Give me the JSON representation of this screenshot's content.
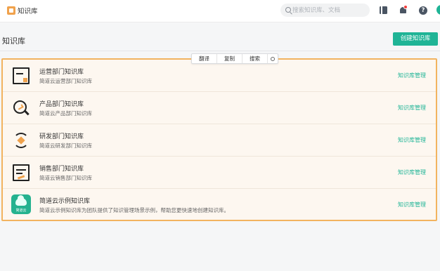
{
  "topbar": {
    "app_title": "知识库",
    "search_placeholder": "搜索知识库、文档",
    "icons": [
      "document-icon",
      "bell-icon",
      "help-icon",
      "avatar"
    ]
  },
  "page": {
    "title": "知识库",
    "create_button": "创建知识库"
  },
  "toolbar": {
    "items": [
      "翻译",
      "复制",
      "搜索"
    ],
    "settings_icon": "gear-icon"
  },
  "knowledge_bases": [
    {
      "name": "运营部门知识库",
      "desc": "简道云运营部门知识库",
      "action": "知识库管理",
      "icon": "ops-icon"
    },
    {
      "name": "产品部门知识库",
      "desc": "简道云产品部门知识库",
      "action": "知识库管理",
      "icon": "product-icon"
    },
    {
      "name": "研发部门知识库",
      "desc": "简道云研发部门知识库",
      "action": "知识库管理",
      "icon": "dev-icon"
    },
    {
      "name": "销售部门知识库",
      "desc": "简道云销售部门知识库",
      "action": "知识库管理",
      "icon": "sales-icon"
    },
    {
      "name": "简道云示例知识库",
      "desc": "简道云示例知识库为团队提供了知识管理场景示例，帮助您更快速地创建知识库。",
      "action": "知识库管理",
      "icon": "demo-kb-icon",
      "icon_brand": "简道云"
    }
  ],
  "colors": {
    "accent": "#1fb496",
    "highlight_border": "#f2b35f",
    "icon_accent": "#f0a24c"
  }
}
